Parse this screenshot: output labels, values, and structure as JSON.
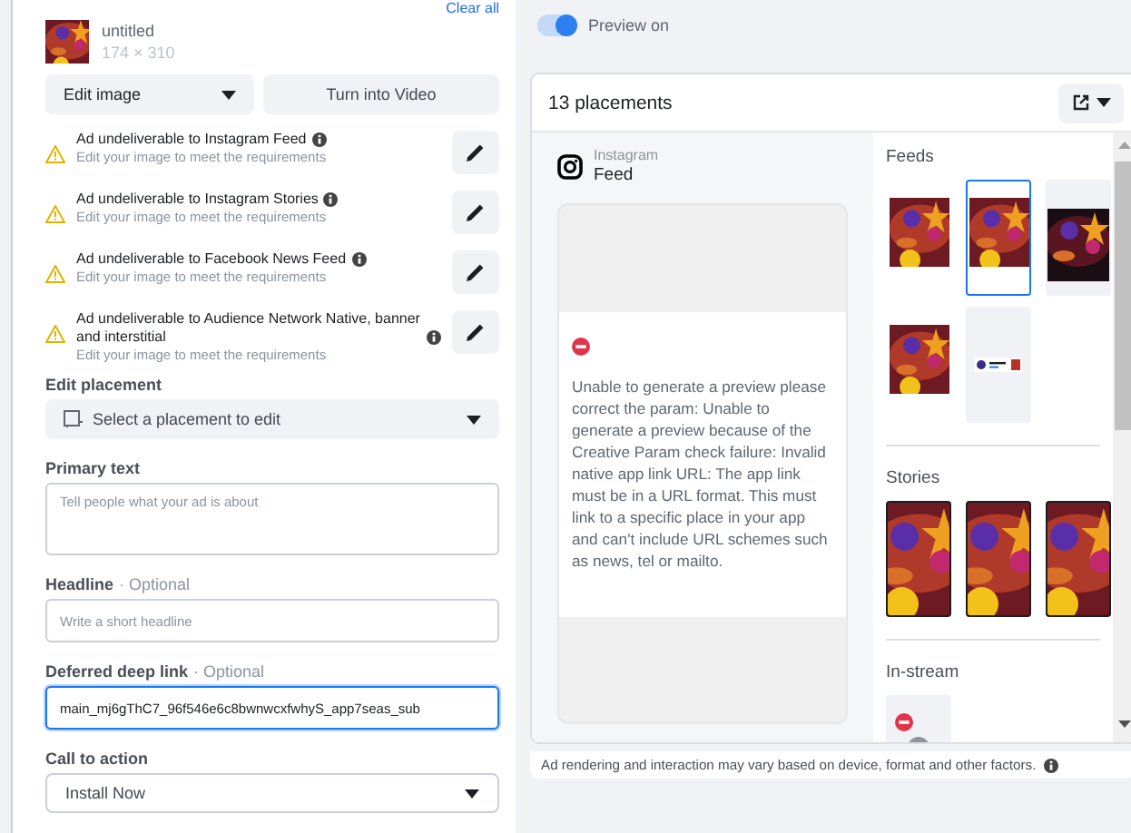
{
  "left": {
    "clear_all": "Clear all",
    "media": {
      "name": "untitled",
      "size": "174 × 310"
    },
    "edit_image": "Edit image",
    "turn_into_video": "Turn into Video",
    "warnings": [
      {
        "title": "Ad undeliverable to Instagram Feed",
        "detail": "Edit your image to meet the requirements"
      },
      {
        "title": "Ad undeliverable to Instagram Stories",
        "detail": "Edit your image to meet the requirements"
      },
      {
        "title": "Ad undeliverable to Facebook News Feed",
        "detail": "Edit your image to meet the requirements"
      },
      {
        "title": "Ad undeliverable to Audience Network Native, banner and interstitial",
        "detail": "Edit your image to meet the requirements"
      }
    ],
    "edit_placement": {
      "label": "Edit placement",
      "placeholder": "Select a placement to edit"
    },
    "fields": [
      {
        "kind": "textarea",
        "label": "Primary text",
        "placeholder": "Tell people what your ad is about",
        "focused": false
      },
      {
        "kind": "input",
        "label": "Headline",
        "optional": "· Optional",
        "placeholder": "Write a short headline",
        "focused": false
      },
      {
        "kind": "input",
        "label": "Deferred deep link",
        "optional": "· Optional",
        "value": "main_mj6gThC7_96f546e6c8bwnwcxfwhyS_app7seas_sub",
        "focused": true
      },
      {
        "kind": "select",
        "label": "Call to action",
        "value": "Install Now",
        "focused": false
      }
    ]
  },
  "preview": {
    "toggle": {
      "label": "Preview on",
      "on": true
    },
    "count": "13 placements",
    "platform": "Instagram",
    "placement": "Feed",
    "error": "Unable to generate a preview please correct the param: Unable to generate a preview because of the Creative Param check failure: Invalid native app link URL: The app link must be in a URL format. This must link to a specific place in your app and can't include URL schemes such as news, tel or mailto.",
    "sections": [
      {
        "title": "Feeds",
        "thumbnails": [
          {
            "kind": "post",
            "selected": false
          },
          {
            "kind": "post",
            "selected": true
          },
          {
            "kind": "dark",
            "selected": false
          },
          {
            "kind": "post",
            "selected": false
          },
          {
            "kind": "card",
            "selected": false
          }
        ]
      },
      {
        "title": "Stories",
        "thumbnails": [
          {
            "kind": "story",
            "selected": false
          },
          {
            "kind": "story",
            "selected": false
          },
          {
            "kind": "story",
            "selected": false
          }
        ]
      },
      {
        "title": "In-stream",
        "thumbnails": [
          {
            "kind": "error",
            "selected": false
          }
        ]
      }
    ],
    "footer": "Ad rendering and interaction may vary based on device, format and other factors."
  }
}
